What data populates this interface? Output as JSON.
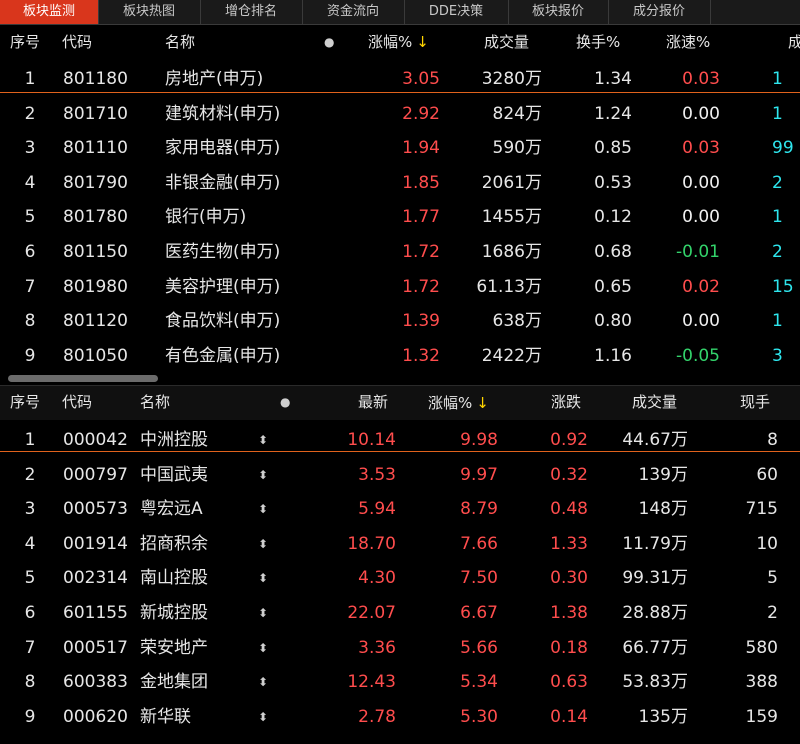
{
  "tabs": [
    {
      "label": "板块监测",
      "active": true
    },
    {
      "label": "板块热图",
      "active": false
    },
    {
      "label": "增仓排名",
      "active": false
    },
    {
      "label": "资金流向",
      "active": false
    },
    {
      "label": "DDE决策",
      "active": false
    },
    {
      "label": "板块报价",
      "active": false
    },
    {
      "label": "成分报价",
      "active": false
    }
  ],
  "upper": {
    "headers": {
      "seq": "序号",
      "code": "代码",
      "name": "名称",
      "dot": "●",
      "change": "涨幅%",
      "sort_arrow": "↓",
      "volume": "成交量",
      "turnover": "换手%",
      "speed": "涨速%",
      "extra": "成"
    },
    "rows": [
      {
        "seq": "1",
        "code": "801180",
        "name": "房地产(申万)",
        "change": "3.05",
        "volume": "3280万",
        "turnover": "1.34",
        "speed": "0.03",
        "speed_color": "red",
        "extra": "1",
        "extra_color": "cyan"
      },
      {
        "seq": "2",
        "code": "801710",
        "name": "建筑材料(申万)",
        "change": "2.92",
        "volume": "824万",
        "turnover": "1.24",
        "speed": "0.00",
        "speed_color": "white",
        "extra": "1",
        "extra_color": "cyan"
      },
      {
        "seq": "3",
        "code": "801110",
        "name": "家用电器(申万)",
        "change": "1.94",
        "volume": "590万",
        "turnover": "0.85",
        "speed": "0.03",
        "speed_color": "red",
        "extra": "99",
        "extra_color": "cyan"
      },
      {
        "seq": "4",
        "code": "801790",
        "name": "非银金融(申万)",
        "change": "1.85",
        "volume": "2061万",
        "turnover": "0.53",
        "speed": "0.00",
        "speed_color": "white",
        "extra": "2",
        "extra_color": "cyan"
      },
      {
        "seq": "5",
        "code": "801780",
        "name": "银行(申万)",
        "change": "1.77",
        "volume": "1455万",
        "turnover": "0.12",
        "speed": "0.00",
        "speed_color": "white",
        "extra": "1",
        "extra_color": "cyan"
      },
      {
        "seq": "6",
        "code": "801150",
        "name": "医药生物(申万)",
        "change": "1.72",
        "volume": "1686万",
        "turnover": "0.68",
        "speed": "-0.01",
        "speed_color": "green",
        "extra": "2",
        "extra_color": "cyan"
      },
      {
        "seq": "7",
        "code": "801980",
        "name": "美容护理(申万)",
        "change": "1.72",
        "volume": "61.13万",
        "turnover": "0.65",
        "speed": "0.02",
        "speed_color": "red",
        "extra": "15",
        "extra_color": "cyan"
      },
      {
        "seq": "8",
        "code": "801120",
        "name": "食品饮料(申万)",
        "change": "1.39",
        "volume": "638万",
        "turnover": "0.80",
        "speed": "0.00",
        "speed_color": "white",
        "extra": "1",
        "extra_color": "cyan"
      },
      {
        "seq": "9",
        "code": "801050",
        "name": "有色金属(申万)",
        "change": "1.32",
        "volume": "2422万",
        "turnover": "1.16",
        "speed": "-0.05",
        "speed_color": "green",
        "extra": "3",
        "extra_color": "cyan"
      }
    ]
  },
  "lower": {
    "headers": {
      "seq": "序号",
      "code": "代码",
      "name": "名称",
      "dot": "●",
      "latest": "最新",
      "change": "涨幅%",
      "sort_arrow": "↓",
      "diff": "涨跌",
      "volume": "成交量",
      "current": "现手"
    },
    "rows": [
      {
        "seq": "1",
        "code": "000042",
        "name": "中洲控股",
        "mark": "⬍",
        "latest": "10.14",
        "change": "9.98",
        "diff": "0.92",
        "volume": "44.67万",
        "current": "8"
      },
      {
        "seq": "2",
        "code": "000797",
        "name": "中国武夷",
        "mark": "⬍",
        "latest": "3.53",
        "change": "9.97",
        "diff": "0.32",
        "volume": "139万",
        "current": "60"
      },
      {
        "seq": "3",
        "code": "000573",
        "name": "粤宏远A",
        "mark": "⬍",
        "latest": "5.94",
        "change": "8.79",
        "diff": "0.48",
        "volume": "148万",
        "current": "715"
      },
      {
        "seq": "4",
        "code": "001914",
        "name": "招商积余",
        "mark": "⬍",
        "latest": "18.70",
        "change": "7.66",
        "diff": "1.33",
        "volume": "11.79万",
        "current": "10"
      },
      {
        "seq": "5",
        "code": "002314",
        "name": "南山控股",
        "mark": "⬍",
        "latest": "4.30",
        "change": "7.50",
        "diff": "0.30",
        "volume": "99.31万",
        "current": "5"
      },
      {
        "seq": "6",
        "code": "601155",
        "name": "新城控股",
        "mark": "⬍",
        "latest": "22.07",
        "change": "6.67",
        "diff": "1.38",
        "volume": "28.88万",
        "current": "2"
      },
      {
        "seq": "7",
        "code": "000517",
        "name": "荣安地产",
        "mark": "⬍",
        "latest": "3.36",
        "change": "5.66",
        "diff": "0.18",
        "volume": "66.77万",
        "current": "580"
      },
      {
        "seq": "8",
        "code": "600383",
        "name": "金地集团",
        "mark": "⬍",
        "latest": "12.43",
        "change": "5.34",
        "diff": "0.63",
        "volume": "53.83万",
        "current": "388"
      },
      {
        "seq": "9",
        "code": "000620",
        "name": "新华联",
        "mark": "⬍",
        "latest": "2.78",
        "change": "5.30",
        "diff": "0.14",
        "volume": "135万",
        "current": "159"
      }
    ]
  }
}
